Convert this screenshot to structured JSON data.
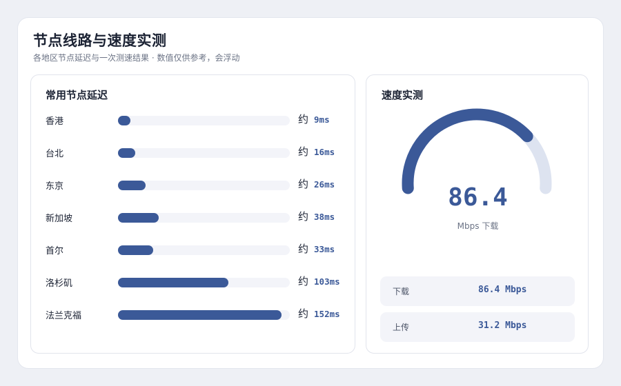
{
  "header": {
    "title": "节点线路与速度实测",
    "subtitle": "各地区节点延迟与一次测速结果 · 数值仅供参考，会浮动"
  },
  "latency_card": {
    "title": "常用节点延迟",
    "approx_label": "约",
    "scale_max_ms": 160,
    "nodes": [
      {
        "name": "香港",
        "latency_ms": 9,
        "label": "9ms"
      },
      {
        "name": "台北",
        "latency_ms": 16,
        "label": "16ms"
      },
      {
        "name": "东京",
        "latency_ms": 26,
        "label": "26ms"
      },
      {
        "name": "新加坡",
        "latency_ms": 38,
        "label": "38ms"
      },
      {
        "name": "首尔",
        "latency_ms": 33,
        "label": "33ms"
      },
      {
        "name": "洛杉矶",
        "latency_ms": 103,
        "label": "103ms"
      },
      {
        "name": "法兰克福",
        "latency_ms": 152,
        "label": "152ms"
      }
    ]
  },
  "speed_card": {
    "title": "速度实测",
    "gauge_value": "86.4",
    "gauge_unit": "Mbps 下载",
    "gauge_fraction": 0.75,
    "stats": [
      {
        "label": "下载",
        "value": "86.4 Mbps"
      },
      {
        "label": "上传",
        "value": "31.2 Mbps"
      }
    ]
  },
  "colors": {
    "accent": "#3b5998",
    "track": "#f3f4f9",
    "gauge_track": "#dde3f0"
  }
}
